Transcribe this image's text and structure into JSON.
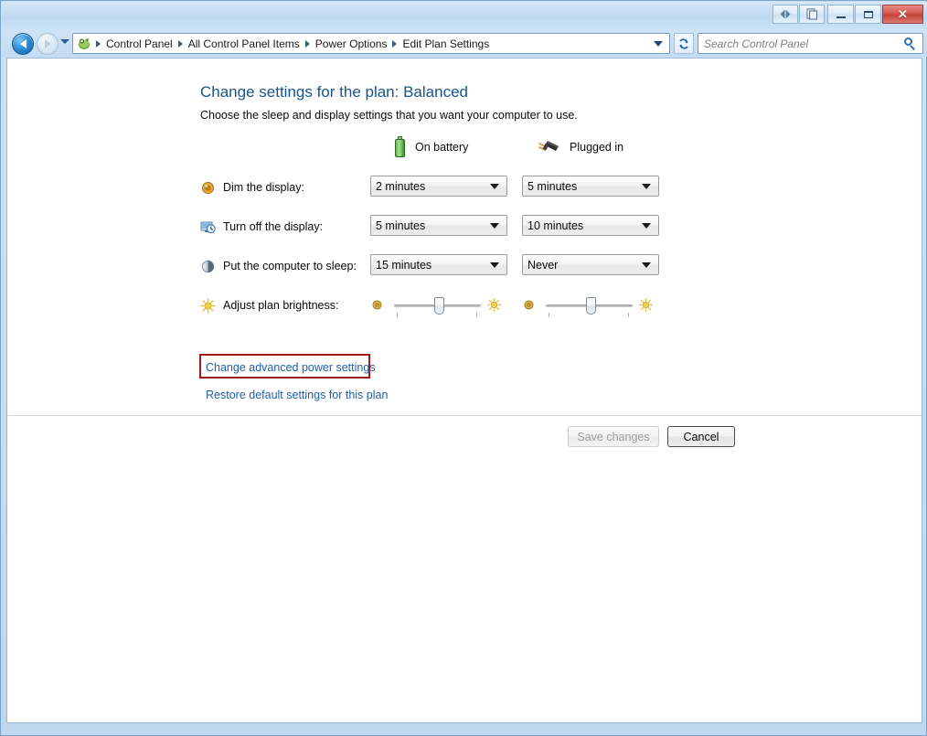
{
  "window": {
    "titlebar_buttons": [
      {
        "name": "compatibility-view",
        "glyph": "◁▷"
      },
      {
        "name": "page-properties",
        "glyph": "❐"
      },
      {
        "name": "minimize",
        "glyph": ""
      },
      {
        "name": "maximize",
        "glyph": ""
      },
      {
        "name": "close",
        "glyph": "✕"
      }
    ]
  },
  "navbar": {
    "back_tooltip": "Back",
    "forward_tooltip": "Forward",
    "breadcrumbs": [
      "Control Panel",
      "All Control Panel Items",
      "Power Options",
      "Edit Plan Settings"
    ],
    "refresh_glyph": "↻",
    "search": {
      "placeholder": "Search Control Panel",
      "value": ""
    }
  },
  "page": {
    "title": "Change settings for the plan: Balanced",
    "subtitle": "Choose the sleep and display settings that you want your computer to use.",
    "columns": [
      {
        "name": "on-battery",
        "label": "On battery",
        "icon": "battery-icon"
      },
      {
        "name": "plugged-in",
        "label": "Plugged in",
        "icon": "plug-icon"
      }
    ],
    "settings": [
      {
        "name": "dim-the-display",
        "icon": "dim-display-icon",
        "label": "Dim the display:",
        "on_battery": "2 minutes",
        "plugged_in": "5 minutes"
      },
      {
        "name": "turn-off-the-display",
        "icon": "monitor-clock-icon",
        "label": "Turn off the display:",
        "on_battery": "5 minutes",
        "plugged_in": "10 minutes"
      },
      {
        "name": "put-the-computer-to-sleep",
        "icon": "sleep-moon-icon",
        "label": "Put the computer to sleep:",
        "on_battery": "15 minutes",
        "plugged_in": "Never"
      }
    ],
    "brightness": {
      "name": "adjust-plan-brightness",
      "icon": "sun-icon",
      "label": "Adjust plan brightness:",
      "on_battery_percent": 45,
      "plugged_in_percent": 45
    },
    "links": [
      {
        "name": "change-advanced-power-settings",
        "label": "Change advanced power settings",
        "highlighted": true
      },
      {
        "name": "restore-default-settings",
        "label": "Restore default settings for this plan",
        "highlighted": false
      }
    ],
    "buttons": {
      "save": {
        "label": "Save changes",
        "enabled": false
      },
      "cancel": {
        "label": "Cancel",
        "enabled": true
      }
    },
    "highlight_color": "#a01c1c",
    "link_color": "#1f5fa8",
    "title_color": "#19548a"
  }
}
